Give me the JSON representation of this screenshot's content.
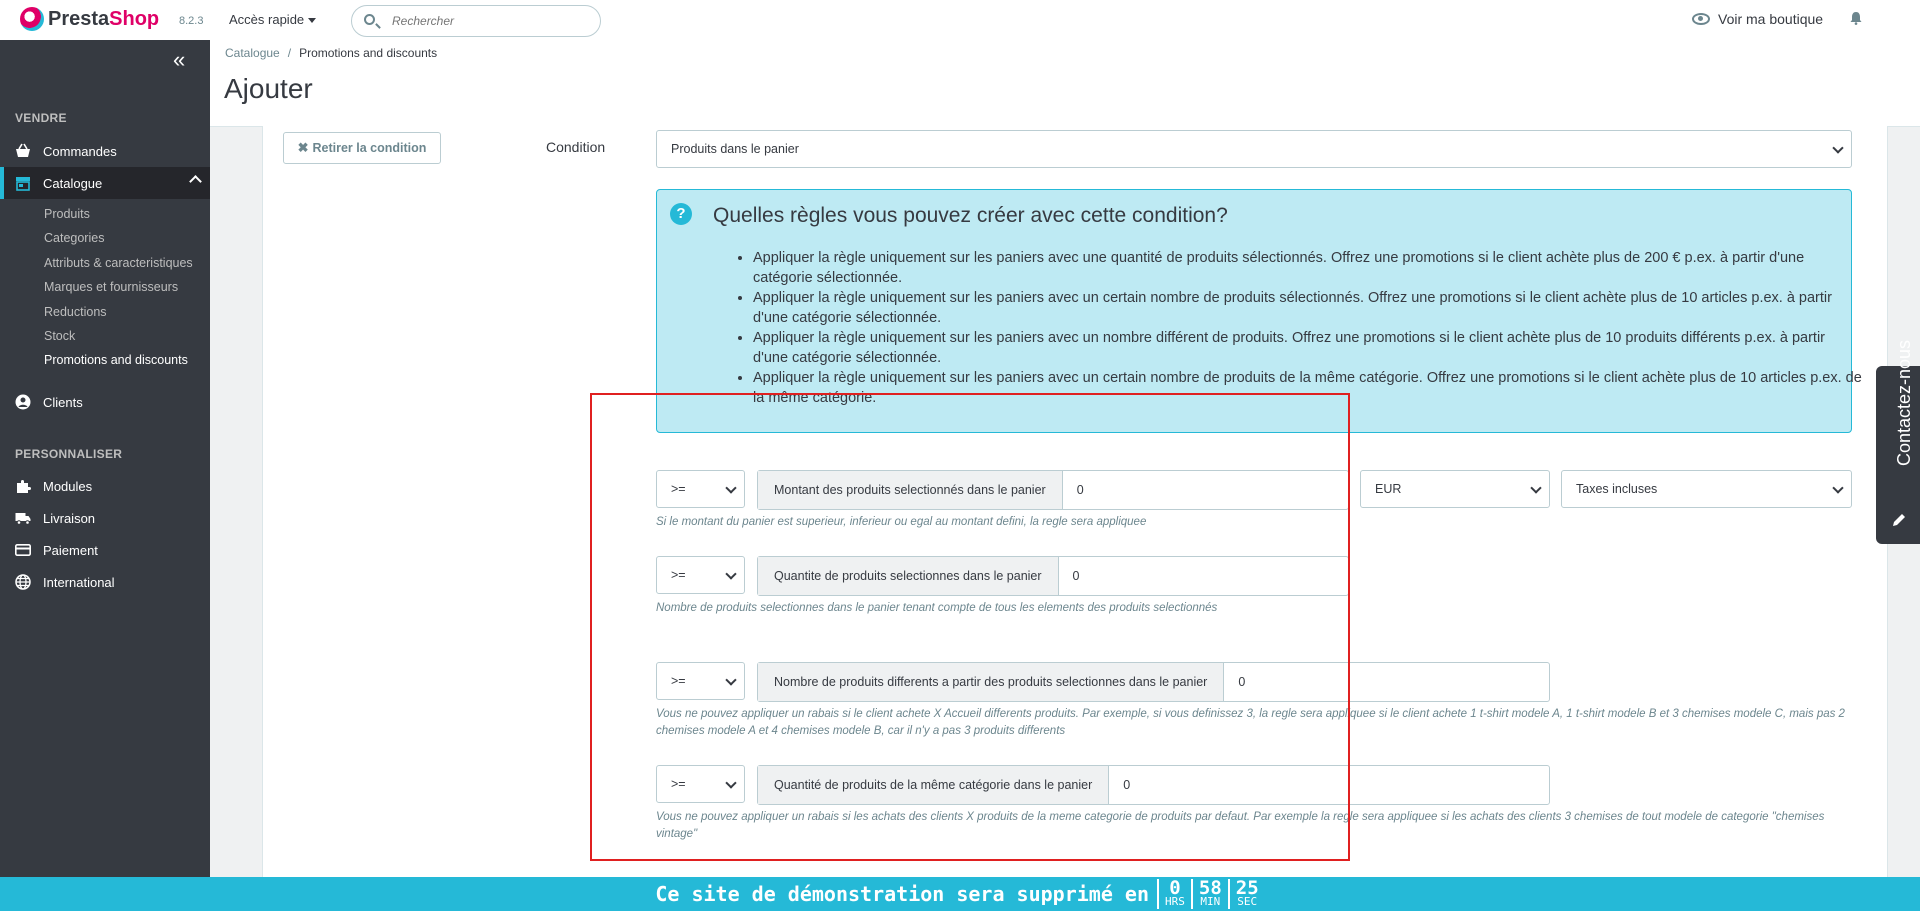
{
  "topbar": {
    "brand_part1": "Presta",
    "brand_part2": "Shop",
    "version": "8.2.3",
    "quick_access": "Accès rapide",
    "search_placeholder": "Rechercher",
    "view_shop": "Voir ma boutique"
  },
  "sidebar": {
    "section_sell": "VENDRE",
    "commandes": "Commandes",
    "catalogue": "Catalogue",
    "sub": [
      "Produits",
      "Categories",
      "Attributs & caracteristiques",
      "Marques et fournisseurs",
      "Reductions",
      "Stock",
      "Promotions and discounts"
    ],
    "clients": "Clients",
    "section_custom": "PERSONNALISER",
    "modules": "Modules",
    "livraison": "Livraison",
    "paiement": "Paiement",
    "international": "International"
  },
  "header": {
    "breadcrumb_1": "Catalogue",
    "breadcrumb_sep": "/",
    "breadcrumb_2": "Promotions and discounts",
    "title": "Ajouter"
  },
  "form": {
    "remove_condition": "Retirer la condition",
    "condition_label": "Condition",
    "condition_value": "Produits dans le panier",
    "help_title": "Quelles règles vous pouvez créer avec cette condition?",
    "help_items": [
      "Appliquer la règle uniquement sur les paniers avec une quantité de produits sélectionnés. Offrez une promotions si le client achète plus de 200 € p.ex. à partir d'une catégorie sélectionnée.",
      "Appliquer la règle uniquement sur les paniers avec un certain nombre de produits sélectionnés. Offrez une promotions si le client achète plus de 10 articles p.ex. à partir d'une catégorie sélectionnée.",
      "Appliquer la règle uniquement sur les paniers avec un nombre différent de produits. Offrez une promotions si le client achète plus de 10 produits différents p.ex. à partir d'une catégorie sélectionnée.",
      "Appliquer la règle uniquement sur les paniers avec un certain nombre de produits de la même catégorie. Offrez une promotions si le client achète plus de 10 articles p.ex. de la même catégorie."
    ],
    "rows": [
      {
        "operator": ">=",
        "label": "Montant des produits selectionnés dans le panier",
        "value": "0",
        "currency": "EUR",
        "tax": "Taxes incluses",
        "hint": "Si le montant du panier est superieur, inferieur ou egal au montant defini, la regle sera appliquee"
      },
      {
        "operator": ">=",
        "label": "Quantite de produits selectionnes dans le panier",
        "value": "0",
        "hint": "Nombre de produits selectionnes dans le panier tenant compte de tous les elements des produits selectionnés"
      },
      {
        "operator": ">=",
        "label": "Nombre de produits differents a partir des produits selectionnes dans le panier",
        "value": "0",
        "hint": "Vous ne pouvez appliquer un rabais si le client achete X Accueil differents produits. Par exemple, si vous definissez 3, la regle sera appliquee si le client achete 1 t-shirt modele A, 1 t-shirt modele B et 3 chemises modele C, mais pas 2 chemises modele A et 4 chemises modele B, car il n'y a pas 3 produits differents"
      },
      {
        "operator": ">=",
        "label": "Quantité de produits de la même catégorie dans le panier",
        "value": "0",
        "hint": "Vous ne pouvez appliquer un rabais si les achats des clients X produits de la meme categorie de produits par defaut. Par exemple la regle sera appliquee si les achats des clients 3 chemises de tout modele de categorie \"chemises vintage\""
      }
    ]
  },
  "contact_tab": "Contactez-nous",
  "banner": {
    "text": "Ce site de démonstration sera supprimé en",
    "hours": "0",
    "hours_unit": "HRS",
    "minutes": "58",
    "minutes_unit": "MIN",
    "seconds": "25",
    "seconds_unit": "SEC"
  },
  "colors": {
    "accent": "#25b9d7",
    "brand_pink": "#df0067",
    "sidebar_bg": "#363a41",
    "help_bg": "#beeaf3",
    "highlight_box": "#e02020"
  }
}
